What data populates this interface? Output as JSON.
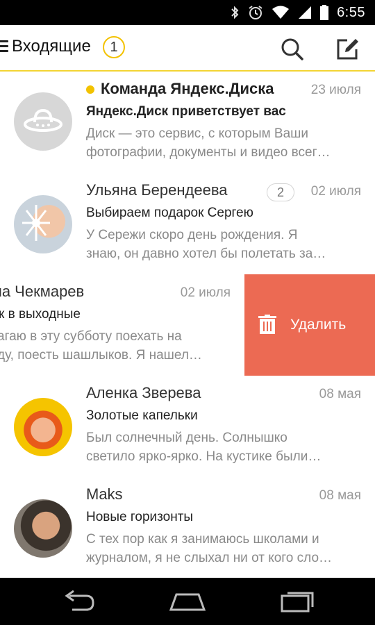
{
  "status_bar": {
    "time": "6:55",
    "icons": [
      "bluetooth-icon",
      "alarm-icon",
      "wifi-icon",
      "signal-icon",
      "battery-icon"
    ]
  },
  "header": {
    "title": "Входящие",
    "unread_count": "1",
    "icons": [
      "menu-icon",
      "search-icon",
      "compose-icon"
    ],
    "accent_color": "#f3d433"
  },
  "messages": [
    {
      "sender": "Команда Яндекс.Диска",
      "date": "23 июля",
      "subject": "Яндекс.Диск приветствует вас",
      "preview_line1": "Диск — это сервис, с которым Ваши",
      "preview_line2": "фотографии, документы и видео всег…",
      "unread": true
    },
    {
      "sender": "Ульяна Берендеева",
      "date": "02 июля",
      "thread_count": "2",
      "subject": "Выбираем подарок Сергею",
      "preview_line1": "У Сережи скоро день рождения. Я",
      "preview_line2": "знаю, он давно хотел бы полетать за…"
    },
    {
      "sender": "ла Чекмарев",
      "date": "02 июля",
      "subject": "к в выходные",
      "preview_line1": "агаю в эту субботу поехать на",
      "preview_line2": "ду, поесть шашлыков. Я нашел…"
    },
    {
      "sender": "Аленка Зверева",
      "date": "08 мая",
      "subject": "Золотые капельки",
      "preview_line1": "Был солнечный день. Солнышко",
      "preview_line2": "светило ярко-ярко. На кустике были…"
    },
    {
      "sender": "Maks",
      "date": "08 мая",
      "subject": "Новые горизонты",
      "preview_line1": "С тех пор как я занимаюсь школами и",
      "preview_line2": "журналом, я не слыхал ни от кого сло…"
    }
  ],
  "swipe_action": {
    "label": "Удалить",
    "icon": "trash-icon",
    "color": "#ec6a53"
  },
  "nav_bar": {
    "buttons": [
      "back-icon",
      "home-icon",
      "recent-apps-icon"
    ]
  }
}
